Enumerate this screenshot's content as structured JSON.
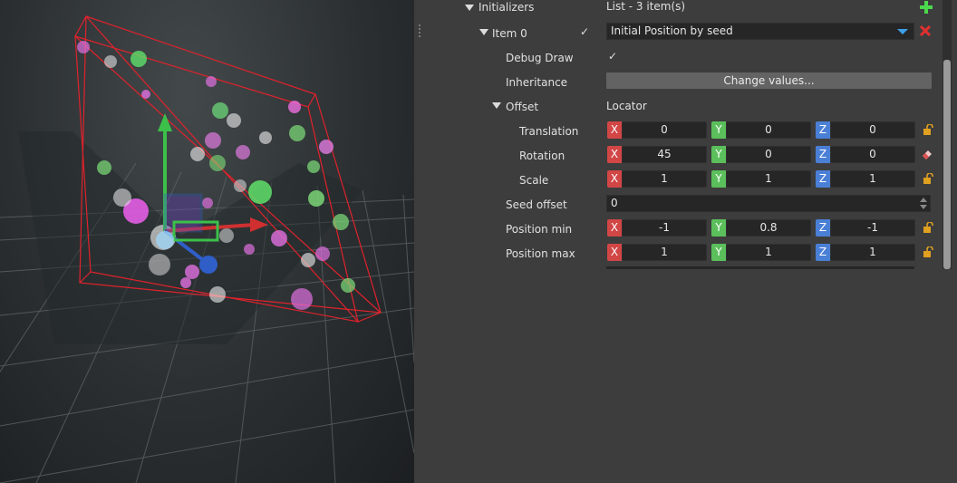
{
  "panel": {
    "initializers": {
      "label": "Initializers",
      "value": "List - 3 item(s)"
    },
    "item0": {
      "label": "Item 0",
      "enabled_mark": "✓",
      "dropdown_value": "Initial Position by seed"
    },
    "debug_draw": {
      "label": "Debug Draw",
      "mark": "✓"
    },
    "inheritance": {
      "label": "Inheritance",
      "button": "Change values..."
    },
    "offset": {
      "label": "Offset",
      "value": "Locator"
    },
    "translation": {
      "label": "Translation",
      "x": "0",
      "y": "0",
      "z": "0"
    },
    "rotation": {
      "label": "Rotation",
      "x": "45",
      "y": "0",
      "z": "0"
    },
    "scale": {
      "label": "Scale",
      "x": "1",
      "y": "1",
      "z": "1"
    },
    "seed_offset": {
      "label": "Seed offset",
      "value": "0"
    },
    "position_min": {
      "label": "Position min",
      "x": "-1",
      "y": "0.8",
      "z": "-1"
    },
    "position_max": {
      "label": "Position max",
      "x": "1",
      "y": "1",
      "z": "1"
    },
    "axis_labels": {
      "x": "X",
      "y": "Y",
      "z": "Z"
    }
  },
  "colors": {
    "x_axis": "#d24646",
    "y_axis": "#5bbf5b",
    "z_axis": "#4a7fd6",
    "add": "#4cd84c",
    "remove": "#e03030",
    "lock": "#e0a020",
    "panel_bg": "#3d3d3d",
    "field_bg": "#262626"
  },
  "icons": {
    "add": "plus-icon",
    "remove": "close-icon",
    "lock": "lock-icon",
    "reset": "eraser-icon",
    "expand": "triangle-down-icon"
  }
}
